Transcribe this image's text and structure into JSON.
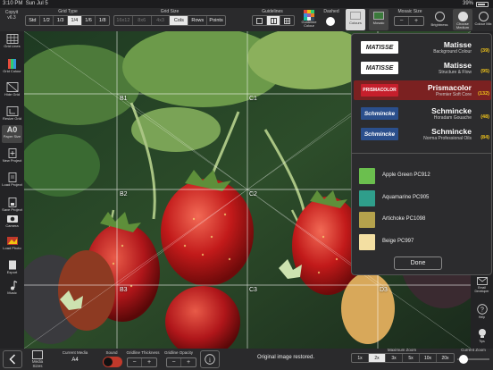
{
  "status": {
    "time": "3:10 PM",
    "date": "Sun Jul 5",
    "battery": "39%"
  },
  "app": {
    "name": "Copyit",
    "version": "v6.3"
  },
  "toolbar": {
    "grid_type_label": "Grid Type",
    "grid_type_options": [
      "Std",
      "1/2",
      "1/3",
      "1/4",
      "1/6",
      "1/8"
    ],
    "grid_type_selected": "1/4",
    "grid_size_label": "Grid Size",
    "grid_size_options": [
      "16x12",
      "8x6",
      "4x3",
      "Cols",
      "Rows",
      "Points"
    ],
    "grid_size_selected": "Cols",
    "guidelines_label": "Guidelines",
    "guideline_colour_label": "Guideline Colour",
    "dashed_label": "Dashed",
    "colours_label": "Colours",
    "mosaic_label": "Mosaic",
    "mosaic_size_label": "Mosaic Size",
    "minus": "−",
    "plus": "+",
    "brightness_label": "Brightness",
    "choose_medium_label": "Choose Medium",
    "colour_mix_label": "Colour Mix"
  },
  "sidebar": {
    "items": [
      {
        "label": "Grid Lines",
        "icon": "grid-icon"
      },
      {
        "label": "Grid Colour",
        "icon": "palette-icon"
      },
      {
        "label": "Hide Grid",
        "icon": "hide-grid-icon"
      },
      {
        "label": "Resize Grid",
        "icon": "resize-grid-icon"
      },
      {
        "label": "A0",
        "icon": "paper-size-icon",
        "sub": "Paper Size"
      },
      {
        "label": "New Project",
        "icon": "new-project-icon"
      },
      {
        "label": "Load Project",
        "icon": "load-project-icon"
      },
      {
        "label": "Save Project",
        "icon": "save-project-icon"
      },
      {
        "label": "Camera",
        "icon": "camera-icon"
      },
      {
        "label": "Load Photo",
        "icon": "load-photo-icon"
      },
      {
        "label": "Export",
        "icon": "export-icon"
      },
      {
        "label": "Music",
        "icon": "music-icon"
      }
    ]
  },
  "canvas": {
    "labels": [
      "B1",
      "C1",
      "B2",
      "C2",
      "B3",
      "C3",
      "D3"
    ],
    "status_text": "Original image restored."
  },
  "right_sidebar": {
    "items": [
      {
        "label": "Email Developer",
        "icon": "email-icon"
      },
      {
        "label": "Help",
        "icon": "help-icon"
      },
      {
        "label": "Tips",
        "icon": "lightbulb-icon"
      }
    ]
  },
  "colour_panel": {
    "brands": [
      {
        "logo": "MATISSE",
        "name": "Matisse",
        "sub": "Background Colour",
        "count": "(39)",
        "selected": false
      },
      {
        "logo": "MATISSE",
        "name": "Matisse",
        "sub": "Structure & Flow",
        "count": "(95)",
        "selected": false
      },
      {
        "logo": "PRISMACOLOR",
        "name": "Prismacolor",
        "sub": "Premier Soft Core",
        "count": "(132)",
        "selected": true
      },
      {
        "logo": "Schmincke",
        "name": "Schmincke",
        "sub": "Horadam Gouache",
        "count": "(48)",
        "selected": false
      },
      {
        "logo": "Schmincke",
        "name": "Schmincke",
        "sub": "Norma Professional Oils",
        "count": "(84)",
        "selected": false
      }
    ],
    "swatches": [
      {
        "name": "Apple Green PC912",
        "color": "#6bbf4e"
      },
      {
        "name": "Aquamarine PC905",
        "color": "#2f9e8b"
      },
      {
        "name": "Artichoke PC1098",
        "color": "#b5a24c"
      },
      {
        "name": "Beige PC997",
        "color": "#f3dfa2"
      }
    ],
    "done_label": "Done"
  },
  "bottombar": {
    "back_icon": "chevron-left-icon",
    "media_sizes_label": "Media Sizes",
    "current_media_label": "Current Media",
    "current_media_value": "A4",
    "sound_label": "Sound",
    "gridline_thickness_label": "Gridline Thickness",
    "gridline_opacity_label": "Gridline Opacity",
    "minus": "−",
    "plus": "+",
    "info_icon": "info-icon",
    "max_zoom_label": "Maximum Zoom",
    "zoom_options": [
      "1x",
      "2x",
      "3x",
      "5x",
      "10x",
      "20x"
    ],
    "zoom_selected": "2x",
    "current_zoom_label": "Current Zoom",
    "current_zoom_value": 0.08
  },
  "colors": {
    "accent": "#7b2121",
    "count": "#f0c419",
    "toggle_on": "#c0392b"
  }
}
